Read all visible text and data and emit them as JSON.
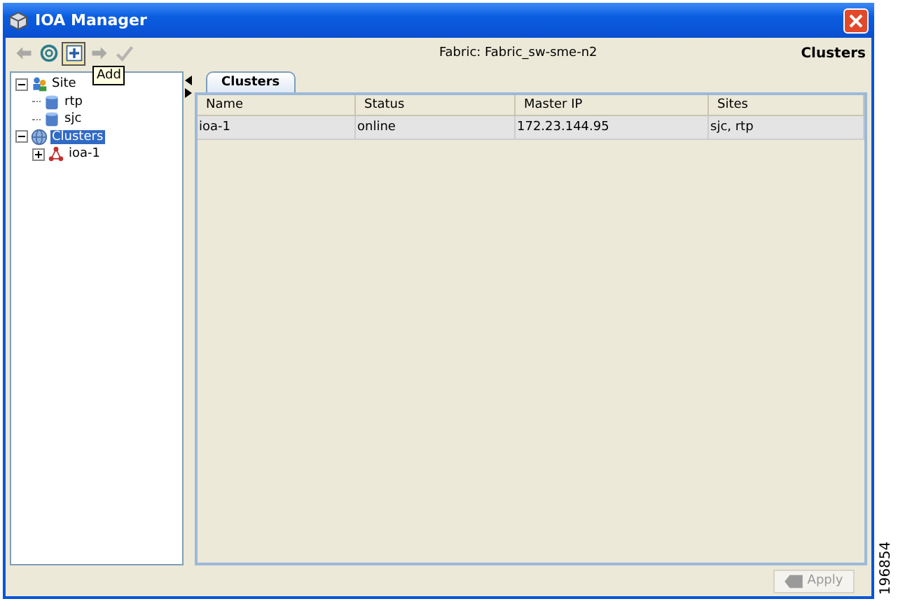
{
  "window": {
    "title": "IOA Manager"
  },
  "toolbar": [
    {
      "kind": "back",
      "disabled": true,
      "hovered": false
    },
    {
      "kind": "refresh",
      "disabled": false,
      "hovered": false
    },
    {
      "kind": "add",
      "disabled": false,
      "hovered": true
    },
    {
      "kind": "forward",
      "disabled": true,
      "hovered": false
    },
    {
      "kind": "apply",
      "disabled": true,
      "hovered": false
    }
  ],
  "tooltip": "Add",
  "fabric_label": "Fabric: Fabric_sw-sme-n2",
  "section_title": "Clusters",
  "tree": [
    {
      "label": "Site",
      "kind": "sites",
      "expanded": true,
      "selected": false,
      "children": [
        {
          "label": "rtp",
          "kind": "site",
          "selected": false
        },
        {
          "label": "sjc",
          "kind": "site",
          "selected": false
        }
      ]
    },
    {
      "label": "Clusters",
      "kind": "clusters",
      "expanded": true,
      "selected": true,
      "children": [
        {
          "label": "ioa-1",
          "kind": "cluster",
          "expanded": false,
          "selected": false
        }
      ]
    }
  ],
  "tabs": [
    {
      "label": "Clusters",
      "selected": true
    }
  ],
  "table": {
    "columns": [
      "Name",
      "Status",
      "Master IP",
      "Sites"
    ],
    "rows": [
      {
        "cells": [
          "ioa-1",
          "online",
          "172.23.144.95",
          "sjc, rtp"
        ],
        "selected": true
      }
    ]
  },
  "apply_button": {
    "label": "Apply",
    "disabled": true
  },
  "figure_id": "196854"
}
